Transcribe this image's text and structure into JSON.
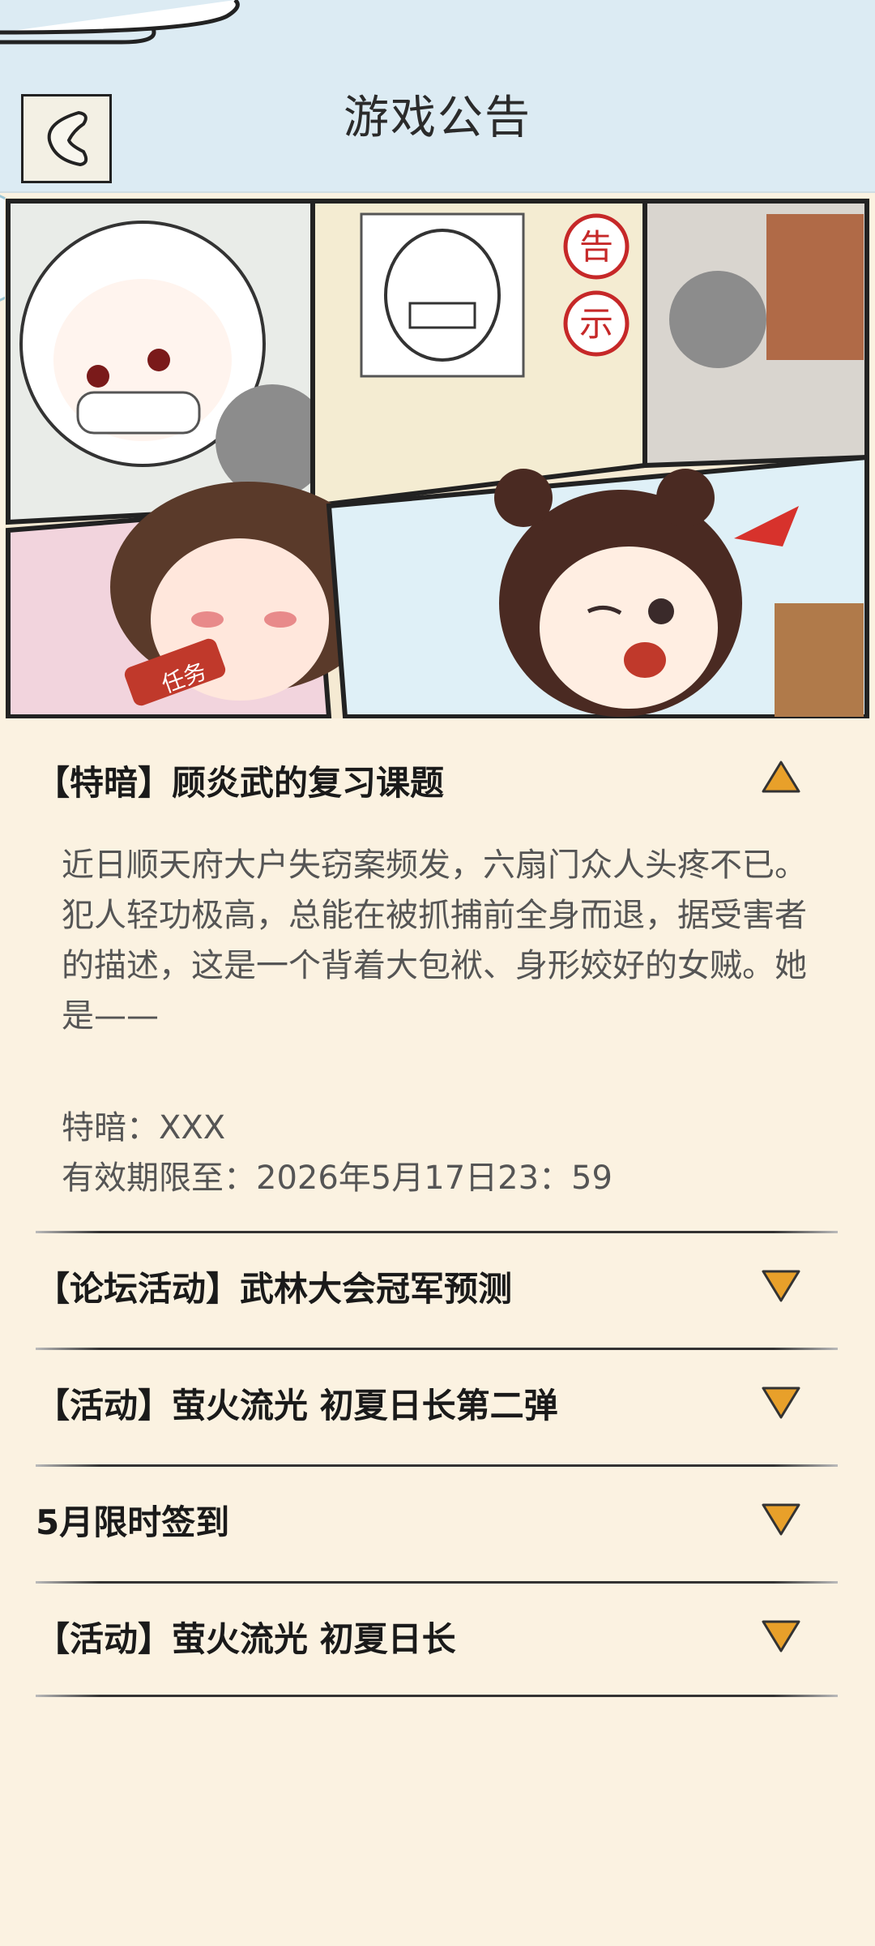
{
  "header": {
    "title": "游戏公告",
    "back_icon": "chevron-left-icon"
  },
  "banner": {
    "sign_chars": [
      "告",
      "示"
    ],
    "scroll_label": "任务"
  },
  "announcements": [
    {
      "title": "【特暗】顾炎武的复习课题",
      "expanded": true,
      "body": "近日顺天府大户失窃案频发，六扇门众人头疼不已。犯人轻功极高，总能在被抓捕前全身而退，据受害者的描述，这是一个背着大包袱、身形姣好的女贼。她是——",
      "code_line": "特暗：XXX",
      "validity": "有效期限至：2026年5月17日23：59"
    },
    {
      "title": "【论坛活动】武林大会冠军预测",
      "expanded": false
    },
    {
      "title": "【活动】萤火流光 初夏日长第二弹",
      "expanded": false
    },
    {
      "title": "5月限时签到",
      "expanded": false
    },
    {
      "title": "【活动】萤火流光 初夏日长",
      "expanded": false
    }
  ],
  "colors": {
    "page_bg": "#fbf2e1",
    "header_bg": "#dcebf3",
    "arrow_fill": "#e8a02a"
  }
}
